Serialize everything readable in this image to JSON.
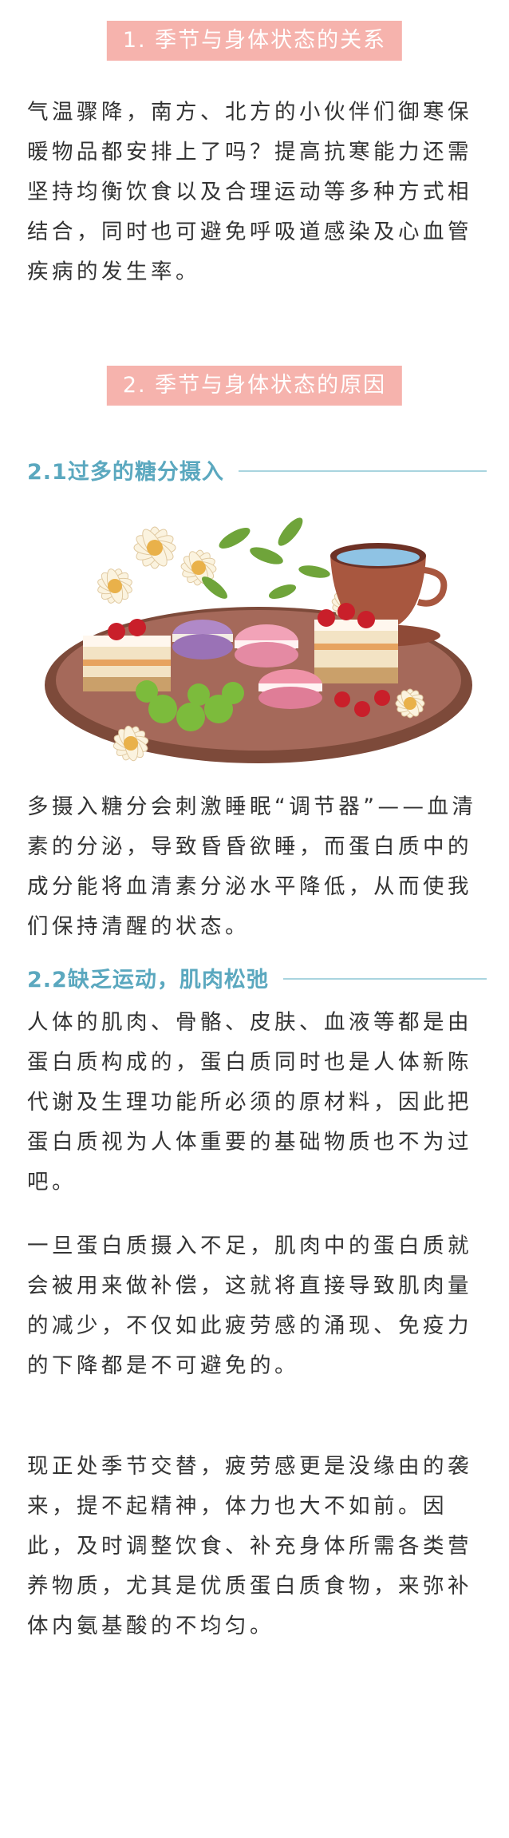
{
  "sections": [
    {
      "heading": "1. 季节与身体状态的关系",
      "paragraph": "气温骤降，南方、北方的小伙伴们御寒保暖物品都安排上了吗？提高抗寒能力还需坚持均衡饮食以及合理运动等多种方式相结合，同时也可避免呼吸道感染及心血管疾病的发生率。"
    },
    {
      "heading": "2. 季节与身体状态的原因",
      "subsections": [
        {
          "title": "2.1过多的糖分摄入",
          "paragraph": "多摄入糖分会刺激睡眠“调节器”——血清素的分泌，导致昏昏欲睡，而蛋白质中的成分能将血清素分泌水平降低，从而使我们保持清醒的状态。"
        },
        {
          "title": "2.2缺乏运动，肌肉松弛",
          "paragraphs": [
            "人体的肌肉、骨骼、皮肤、血液等都是由蛋白质构成的，蛋白质同时也是人体新陈代谢及生理功能所必须的原材料，因此把蛋白质视为人体重要的基础物质也不为过吧。",
            "一旦蛋白质摄入不足，肌肉中的蛋白质就会被用来做补偿，这就将直接导致肌肉量的减少，不仅如此疲劳感的涌现、免疫力的下降都是不可避免的。",
            "现正处季节交替，疲劳感更是没缘由的袭来，提不起精神，体力也大不如前。因此，及时调整饮食、补充身体所需各类营养物质，尤其是优质蛋白质食物，来弥补体内氨基酸的不均匀。"
          ]
        }
      ]
    }
  ],
  "colors": {
    "pill_bg": "#f6b3ad",
    "subtitle": "#5ba8bf",
    "subtitle_line": "#a9d4df",
    "text": "#333333"
  },
  "image": {
    "subject": "tray of cakes, macarons and berries with a cup of tea and daisies"
  }
}
